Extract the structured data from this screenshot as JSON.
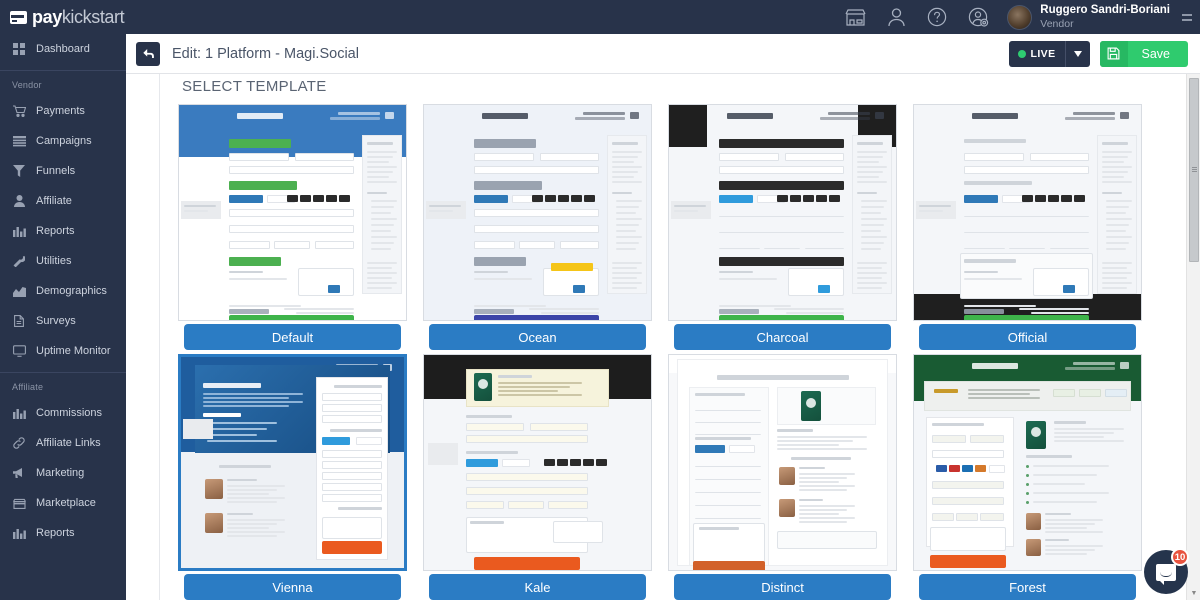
{
  "brand": {
    "pay": "pay",
    "kickstart": "kickstart",
    "icon": "card-icon"
  },
  "topbar": {
    "icons": [
      {
        "name": "marketplace-icon",
        "label": "Marketplace"
      },
      {
        "name": "user-icon",
        "label": "Account"
      },
      {
        "name": "help-icon",
        "label": "Help"
      },
      {
        "name": "user-settings-icon",
        "label": "User Settings"
      }
    ],
    "user": {
      "name": "Ruggero Sandri-Boriani",
      "role": "Vendor",
      "avatar": "user-avatar"
    },
    "menu_toggle": "hamburger-icon"
  },
  "sidebar": {
    "top_items": [
      {
        "label": "Dashboard",
        "icon": "grid-icon"
      }
    ],
    "groups": [
      {
        "heading": "Vendor",
        "items": [
          {
            "label": "Payments",
            "icon": "cart-icon"
          },
          {
            "label": "Campaigns",
            "icon": "layers-icon"
          },
          {
            "label": "Funnels",
            "icon": "funnel-icon"
          },
          {
            "label": "Affiliate",
            "icon": "person-icon"
          },
          {
            "label": "Reports",
            "icon": "bar-chart-icon"
          },
          {
            "label": "Utilities",
            "icon": "wrench-icon"
          },
          {
            "label": "Demographics",
            "icon": "area-chart-icon"
          },
          {
            "label": "Surveys",
            "icon": "document-icon"
          },
          {
            "label": "Uptime Monitor",
            "icon": "monitor-icon"
          }
        ]
      },
      {
        "heading": "Affiliate",
        "items": [
          {
            "label": "Commissions",
            "icon": "bar-chart-icon"
          },
          {
            "label": "Affiliate Links",
            "icon": "link-icon"
          },
          {
            "label": "Marketing",
            "icon": "megaphone-icon"
          },
          {
            "label": "Marketplace",
            "icon": "store-icon"
          },
          {
            "label": "Reports",
            "icon": "bar-chart-icon"
          }
        ]
      }
    ]
  },
  "page_header": {
    "back_icon": "back-arrow-icon",
    "title": "Edit: 1 Platform - Magi.Social",
    "status_button": {
      "label": "LIVE",
      "dot_color": "#2ecc71",
      "caret": "▾"
    },
    "save_button": {
      "label": "Save",
      "icon": "floppy-disk-icon"
    }
  },
  "main": {
    "section_title": "SELECT TEMPLATE",
    "templates": [
      {
        "name": "Default",
        "selected": false,
        "style": "default"
      },
      {
        "name": "Ocean",
        "selected": false,
        "style": "ocean"
      },
      {
        "name": "Charcoal",
        "selected": false,
        "style": "charcoal"
      },
      {
        "name": "Official",
        "selected": false,
        "style": "official"
      },
      {
        "name": "Vienna",
        "selected": true,
        "style": "vienna"
      },
      {
        "name": "Kale",
        "selected": false,
        "style": "kale"
      },
      {
        "name": "Distinct",
        "selected": false,
        "style": "distinct"
      },
      {
        "name": "Forest",
        "selected": false,
        "style": "forest"
      }
    ]
  },
  "chat_widget": {
    "badge": "10",
    "icon": "chat-bubble-icon"
  },
  "colors": {
    "sidebar_bg": "#28334a",
    "accent_blue": "#2b7cc4",
    "save_green": "#2fcb6e",
    "live_dot": "#2ecc71",
    "badge_red": "#e8533f"
  }
}
